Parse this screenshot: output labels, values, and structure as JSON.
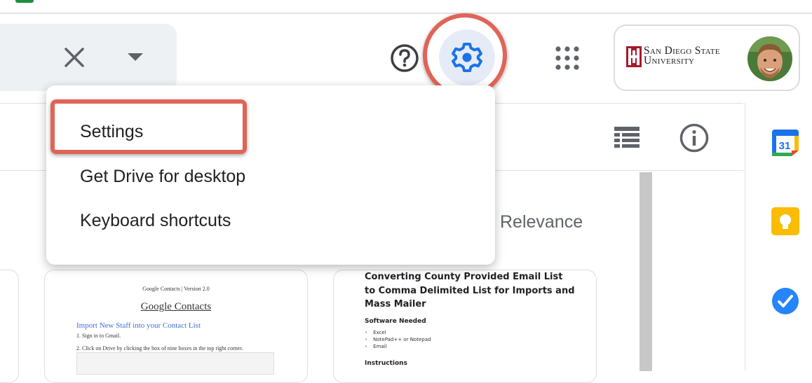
{
  "header": {
    "account_org_line1": "San Diego State",
    "account_org_line2": "University"
  },
  "toolbar": {
    "sort_label": "Relevance"
  },
  "settings_menu": {
    "items": [
      {
        "label": "Settings"
      },
      {
        "label": "Get Drive for desktop"
      },
      {
        "label": "Keyboard shortcuts"
      }
    ]
  },
  "files": [
    {
      "header": "Google Contacts | Version 2.0",
      "title": "Google Contacts",
      "subtitle": "Import New Staff into your Contact List",
      "step1": "1. Sign in to Gmail.",
      "step2": "2. Click on Drive by clicking the box of nine boxes in the top right corner."
    },
    {
      "title": "Converting County Provided Email List to Comma Delimited List for Imports and Mass Mailer",
      "section1": "Software Needed",
      "software": [
        "Excel",
        "NotePad++ or Notepad",
        "Email"
      ],
      "section2": "Instructions"
    }
  ],
  "sidebar_apps": {
    "calendar_day": "31"
  },
  "colors": {
    "accent_blue": "#1a73e8",
    "highlight_red": "#e06457",
    "gear_bg": "#e6ecf7"
  }
}
